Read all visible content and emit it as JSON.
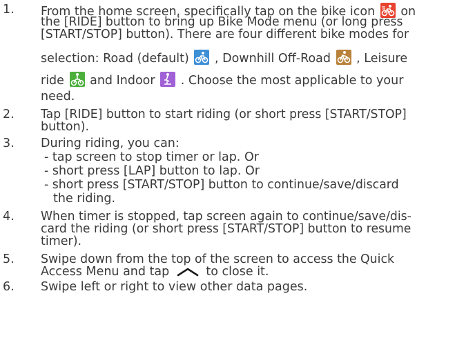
{
  "steps": [
    {
      "number": "1.",
      "lines": [
        "From the home screen, specifically tap on the bike icon",
        "on",
        "the [RIDE] button to bring up Bike Mode menu (or long press",
        "[START/STOP] button). There are four different bike modes for",
        "selection: Road (default)",
        ", Downhill Off-Road",
        ", Leisure",
        "ride",
        "and Indoor",
        ". Choose the most applicable to your",
        "need."
      ]
    },
    {
      "number": "2.",
      "lines": [
        "Tap [RIDE] button to start riding (or short press [START/STOP]",
        "button)."
      ]
    },
    {
      "number": "3.",
      "lines": [
        "During riding, you can:",
        "- tap screen to stop timer or lap. Or",
        "- short press [LAP] button to lap. Or",
        "- short press [START/STOP] button to continue/save/discard",
        "the riding."
      ]
    },
    {
      "number": "4.",
      "lines": [
        "When timer is stopped, tap screen again to continue/save/dis-",
        "card the riding (or short press [START/STOP] button to resume",
        "timer)."
      ]
    },
    {
      "number": "5.",
      "lines": [
        "Swipe down from the top of the screen to access the Quick",
        "Access Menu and tap",
        "to close it."
      ]
    },
    {
      "number": "6.",
      "lines": [
        "Swipe left or right to view other data pages."
      ]
    }
  ],
  "icons": {
    "ride_mode": "bike-ride-icon",
    "road": "road-bike-icon",
    "downhill": "downhill-bike-icon",
    "leisure": "leisure-ride-icon",
    "indoor": "indoor-bike-icon",
    "chevron_up": "chevron-up-icon"
  },
  "colors": {
    "text": "#3a3a3a",
    "ride_mode_icon": "#e8432f",
    "road_icon": "#3d8fd6",
    "downhill_icon": "#b8823a",
    "leisure_icon": "#4caf3c",
    "indoor_icon": "#a061d6"
  }
}
